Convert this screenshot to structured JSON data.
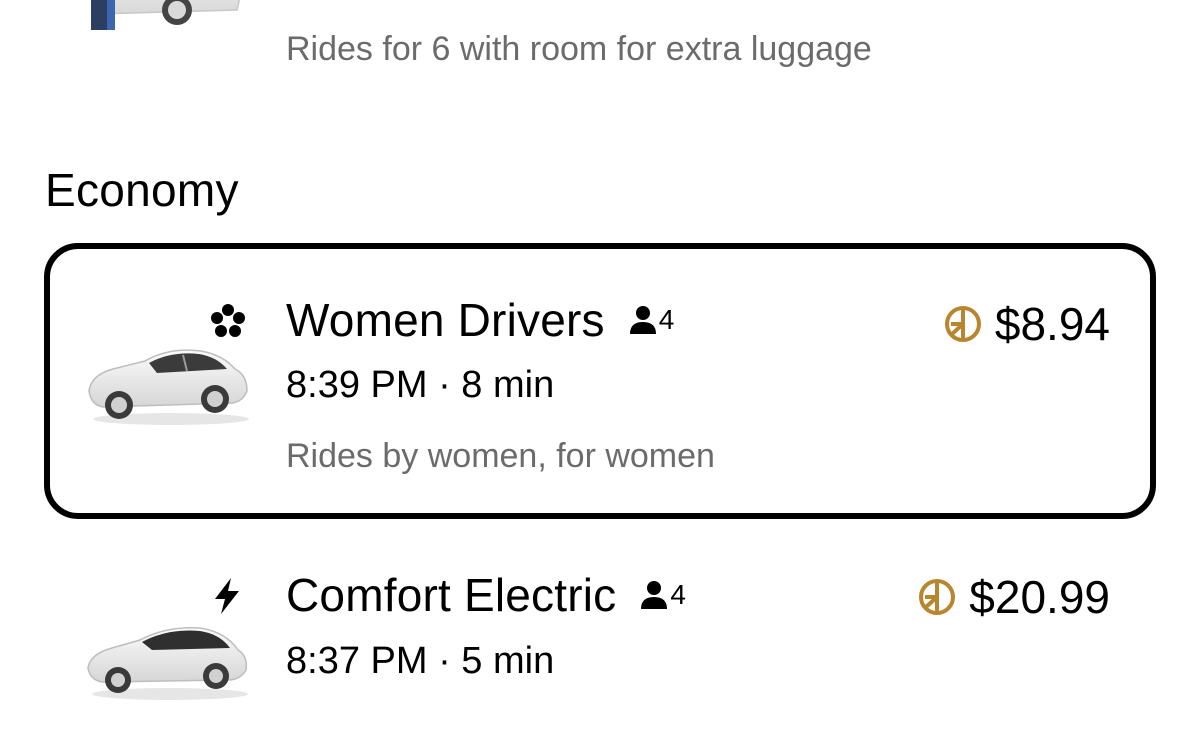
{
  "previous_option": {
    "description": "Rides for 6 with room for extra luggage"
  },
  "section": {
    "title": "Economy"
  },
  "options": [
    {
      "name": "Women Drivers",
      "seats": "4",
      "time": "8:39 PM · 8 min",
      "description": "Rides by women, for women",
      "price": "$8.94",
      "badge_icon": "flower-icon",
      "selected": true
    },
    {
      "name": "Comfort Electric",
      "seats": "4",
      "time": "8:37 PM · 5 min",
      "price": "$20.99",
      "badge_icon": "lightning-bolt-icon",
      "selected": false
    }
  ],
  "colors": {
    "text": "#000000",
    "secondary_text": "#6b6b6b",
    "coin_accent": "#b8862e",
    "selected_border": "#000000"
  }
}
